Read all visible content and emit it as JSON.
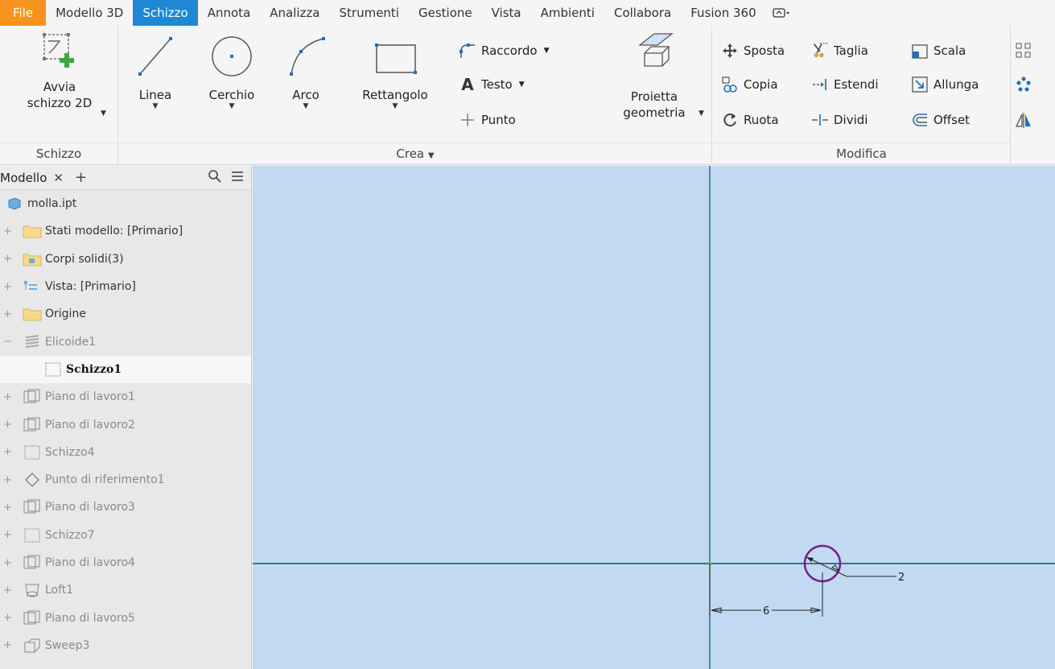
{
  "menu": {
    "tabs": [
      {
        "label": "File"
      },
      {
        "label": "Modello 3D"
      },
      {
        "label": "Schizzo"
      },
      {
        "label": "Annota"
      },
      {
        "label": "Analizza"
      },
      {
        "label": "Strumenti"
      },
      {
        "label": "Gestione"
      },
      {
        "label": "Vista"
      },
      {
        "label": "Ambienti"
      },
      {
        "label": "Collabora"
      },
      {
        "label": "Fusion 360"
      }
    ],
    "active_tab": "Schizzo"
  },
  "ribbon": {
    "schizzo_panel": {
      "title": "Schizzo",
      "start_sketch": {
        "line1": "Avvia",
        "line2": "schizzo 2D"
      }
    },
    "crea_panel": {
      "title": "Crea",
      "linea": "Linea",
      "cerchio": "Cerchio",
      "arco": "Arco",
      "rettangolo": "Rettangolo",
      "raccordo": "Raccordo",
      "testo": "Testo",
      "punto": "Punto",
      "proietta": {
        "line1": "Proietta",
        "line2": "geometria"
      }
    },
    "modifica_panel": {
      "title": "Modifica",
      "sposta": "Sposta",
      "taglia": "Taglia",
      "scala": "Scala",
      "copia": "Copia",
      "estendi": "Estendi",
      "allunga": "Allunga",
      "ruota": "Ruota",
      "dividi": "Dividi",
      "offset": "Offset"
    }
  },
  "browser": {
    "tab_label": "Modello",
    "items": [
      {
        "label": "molla.ipt",
        "icon": "part-icon",
        "state": "normal"
      },
      {
        "label": "Stati modello: [Primario]",
        "icon": "folder-icon",
        "state": "normal"
      },
      {
        "label": "Corpi solidi(3)",
        "icon": "solid-bodies-folder-icon",
        "state": "normal"
      },
      {
        "label": "Vista: [Primario]",
        "icon": "view-icon",
        "state": "normal"
      },
      {
        "label": "Origine",
        "icon": "folder-icon",
        "state": "normal"
      },
      {
        "label": "Elicoide1",
        "icon": "coil-icon",
        "state": "dim"
      },
      {
        "label": "Schizzo1",
        "icon": "sketch-icon",
        "state": "selected"
      },
      {
        "label": "Piano di lavoro1",
        "icon": "workplane-icon",
        "state": "dim"
      },
      {
        "label": "Piano di lavoro2",
        "icon": "workplane-icon",
        "state": "dim"
      },
      {
        "label": "Schizzo4",
        "icon": "sketch-icon",
        "state": "dim"
      },
      {
        "label": "Punto di riferimento1",
        "icon": "workpoint-icon",
        "state": "dim"
      },
      {
        "label": "Piano di lavoro3",
        "icon": "workplane-icon",
        "state": "dim"
      },
      {
        "label": "Schizzo7",
        "icon": "sketch-icon",
        "state": "dim"
      },
      {
        "label": "Piano di lavoro4",
        "icon": "workplane-icon",
        "state": "dim"
      },
      {
        "label": "Loft1",
        "icon": "loft-icon",
        "state": "dim"
      },
      {
        "label": "Piano di lavoro5",
        "icon": "workplane-icon",
        "state": "dim"
      },
      {
        "label": "Sweep3",
        "icon": "sweep-icon",
        "state": "dim"
      }
    ]
  },
  "canvas": {
    "dimension_horizontal": "6",
    "dimension_diameter": "2",
    "background": "#c2daf1",
    "circle_color": "#7b1f8a",
    "axis_color": "#0b4f6c"
  },
  "colors": {
    "file_tab": "#f7941d",
    "active_tab": "#1e88d4"
  }
}
